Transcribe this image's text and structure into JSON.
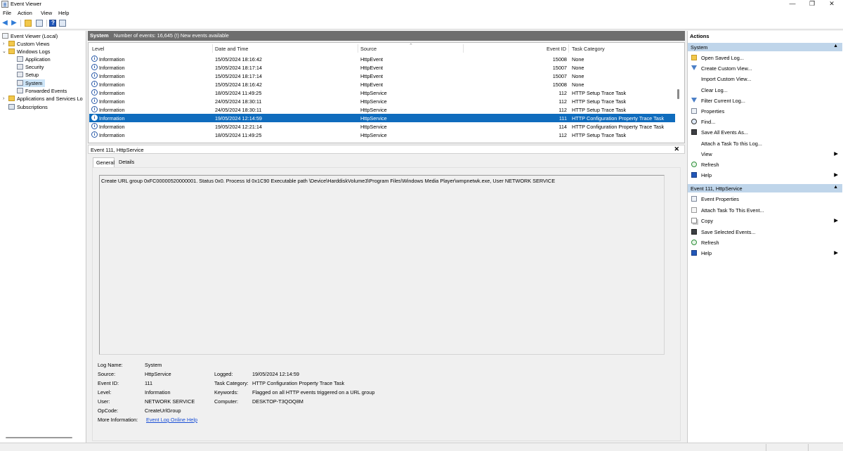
{
  "window": {
    "title": "Event Viewer"
  },
  "menu": [
    "File",
    "Action",
    "View",
    "Help"
  ],
  "tree": {
    "items": [
      {
        "label": "Event Viewer (Local)",
        "icon": "computer-icon"
      },
      {
        "label": "Custom Views",
        "icon": "folder-icon"
      },
      {
        "label": "Windows Logs",
        "icon": "folder-icon"
      },
      {
        "label": "Application",
        "icon": "log-icon"
      },
      {
        "label": "Security",
        "icon": "log-icon"
      },
      {
        "label": "Setup",
        "icon": "log-icon"
      },
      {
        "label": "System",
        "icon": "log-icon"
      },
      {
        "label": "Forwarded Events",
        "icon": "log-icon"
      },
      {
        "label": "Applications and Services Lo",
        "icon": "folder-icon"
      },
      {
        "label": "Subscriptions",
        "icon": "subscription-icon"
      }
    ]
  },
  "log_header": {
    "name": "System",
    "info": "Number of events: 16,645 (!) New events available"
  },
  "columns": [
    "Level",
    "Date and Time",
    "Source",
    "Event ID",
    "Task Category"
  ],
  "events": [
    {
      "level": "Information",
      "date": "15/05/2024 18:16:42",
      "source": "HttpEvent",
      "id": "15008",
      "category": "None"
    },
    {
      "level": "Information",
      "date": "15/05/2024 18:17:14",
      "source": "HttpEvent",
      "id": "15007",
      "category": "None"
    },
    {
      "level": "Information",
      "date": "15/05/2024 18:17:14",
      "source": "HttpEvent",
      "id": "15007",
      "category": "None"
    },
    {
      "level": "Information",
      "date": "15/05/2024 18:16:42",
      "source": "HttpEvent",
      "id": "15008",
      "category": "None"
    },
    {
      "level": "Information",
      "date": "18/05/2024 11:49:25",
      "source": "HttpService",
      "id": "112",
      "category": "HTTP Setup Trace Task"
    },
    {
      "level": "Information",
      "date": "24/05/2024 18:30:11",
      "source": "HttpService",
      "id": "112",
      "category": "HTTP Setup Trace Task"
    },
    {
      "level": "Information",
      "date": "24/05/2024 18:30:11",
      "source": "HttpService",
      "id": "112",
      "category": "HTTP Setup Trace Task"
    },
    {
      "level": "Information",
      "date": "19/05/2024 12:14:59",
      "source": "HttpService",
      "id": "111",
      "category": "HTTP Configuration Property Trace Task"
    },
    {
      "level": "Information",
      "date": "19/05/2024 12:21:14",
      "source": "HttpService",
      "id": "114",
      "category": "HTTP Configuration Property Trace Task"
    },
    {
      "level": "Information",
      "date": "18/05/2024 11:49:25",
      "source": "HttpService",
      "id": "112",
      "category": "HTTP Setup Trace Task"
    }
  ],
  "selected_event_index": 7,
  "detail": {
    "title": "Event 111, HttpService",
    "tabs": [
      "General",
      "Details"
    ],
    "message": "Create URL group 0xFC00000520000001. Status 0x0. Process Id 0x1C90 Executable path \\Device\\HarddiskVolume3\\Program Files\\Windows Media Player\\wmpnetwk.exe, User NETWORK SERVICE",
    "labels": {
      "log_name": "Log Name:",
      "source": "Source:",
      "event_id": "Event ID:",
      "level": "Level:",
      "user": "User:",
      "opcode": "OpCode:",
      "more_info": "More Information:",
      "logged": "Logged:",
      "task_category": "Task Category:",
      "keywords": "Keywords:",
      "computer": "Computer:"
    },
    "values": {
      "log_name": "System",
      "source": "HttpService",
      "event_id": "111",
      "level": "Information",
      "user": "NETWORK SERVICE",
      "opcode": "CreateUrlGroup",
      "more_info": "Event Log Online Help",
      "logged": "19/05/2024 12:14:59",
      "task_category": "HTTP Configuration Property Trace Task",
      "keywords": "Flagged on all HTTP events triggered on a URL group",
      "computer": "DESKTOP-T3QOQ8M"
    }
  },
  "actions": {
    "title": "Actions",
    "sections": [
      {
        "title": "System",
        "items": [
          {
            "label": "Open Saved Log...",
            "icon": "folder-icon"
          },
          {
            "label": "Create Custom View...",
            "icon": "filter-icon"
          },
          {
            "label": "Import Custom View...",
            "icon": ""
          },
          {
            "label": "Clear Log...",
            "icon": ""
          },
          {
            "label": "Filter Current Log...",
            "icon": "filter-icon"
          },
          {
            "label": "Properties",
            "icon": "properties-icon"
          },
          {
            "label": "Find...",
            "icon": "find-icon"
          },
          {
            "label": "Save All Events As...",
            "icon": "save-icon"
          },
          {
            "label": "Attach a Task To this Log...",
            "icon": ""
          },
          {
            "label": "View",
            "icon": "",
            "submenu": true
          },
          {
            "label": "Refresh",
            "icon": "refresh-icon"
          },
          {
            "label": "Help",
            "icon": "help-icon",
            "submenu": true
          }
        ]
      },
      {
        "title": "Event 111, HttpService",
        "items": [
          {
            "label": "Event Properties",
            "icon": "properties-icon"
          },
          {
            "label": "Attach Task To This Event...",
            "icon": "task-icon"
          },
          {
            "label": "Copy",
            "icon": "copy-icon",
            "submenu": true
          },
          {
            "label": "Save Selected Events...",
            "icon": "save-icon"
          },
          {
            "label": "Refresh",
            "icon": "refresh-icon"
          },
          {
            "label": "Help",
            "icon": "help-icon",
            "submenu": true
          }
        ]
      }
    ]
  },
  "colors": {
    "selection": "#0f6cbd",
    "section_header": "#bfd5ea",
    "log_header": "#6e6e6e",
    "link": "#1a4fd6"
  }
}
